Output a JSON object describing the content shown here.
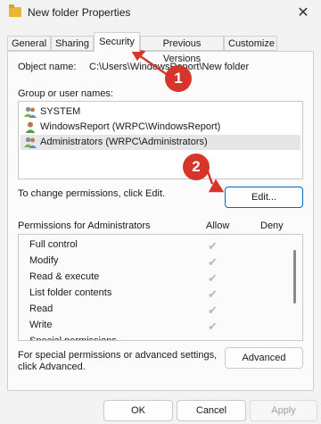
{
  "window": {
    "title": "New folder Properties",
    "close_glyph": "✕"
  },
  "tabs": [
    "General",
    "Sharing",
    "Security",
    "Previous Versions",
    "Customize"
  ],
  "object": {
    "label": "Object name:",
    "value": "C:\\Users\\WindowsReport\\New folder"
  },
  "groups": {
    "label": "Group or user names:",
    "items": [
      {
        "name": "SYSTEM",
        "icon": "users-group-icon"
      },
      {
        "name": "WindowsReport (WRPC\\WindowsReport)",
        "icon": "user-icon"
      },
      {
        "name": "Administrators (WRPC\\Administrators)",
        "icon": "users-group-icon",
        "selected": true
      }
    ]
  },
  "change_text": "To change permissions, click Edit.",
  "edit_label": "Edit...",
  "permissions": {
    "label": "Permissions for Administrators",
    "allow": "Allow",
    "deny": "Deny",
    "items": [
      {
        "name": "Full control",
        "allow": true
      },
      {
        "name": "Modify",
        "allow": true
      },
      {
        "name": "Read & execute",
        "allow": true
      },
      {
        "name": "List folder contents",
        "allow": true
      },
      {
        "name": "Read",
        "allow": true
      },
      {
        "name": "Write",
        "allow": true
      },
      {
        "name": "Special permissions",
        "allow": false
      }
    ]
  },
  "special_text": "For special permissions or advanced settings, click Advanced.",
  "advanced_label": "Advanced",
  "footer": {
    "ok": "OK",
    "cancel": "Cancel",
    "apply": "Apply"
  },
  "annotations": {
    "badge1": "1",
    "badge2": "2",
    "color": "#d6352c"
  }
}
